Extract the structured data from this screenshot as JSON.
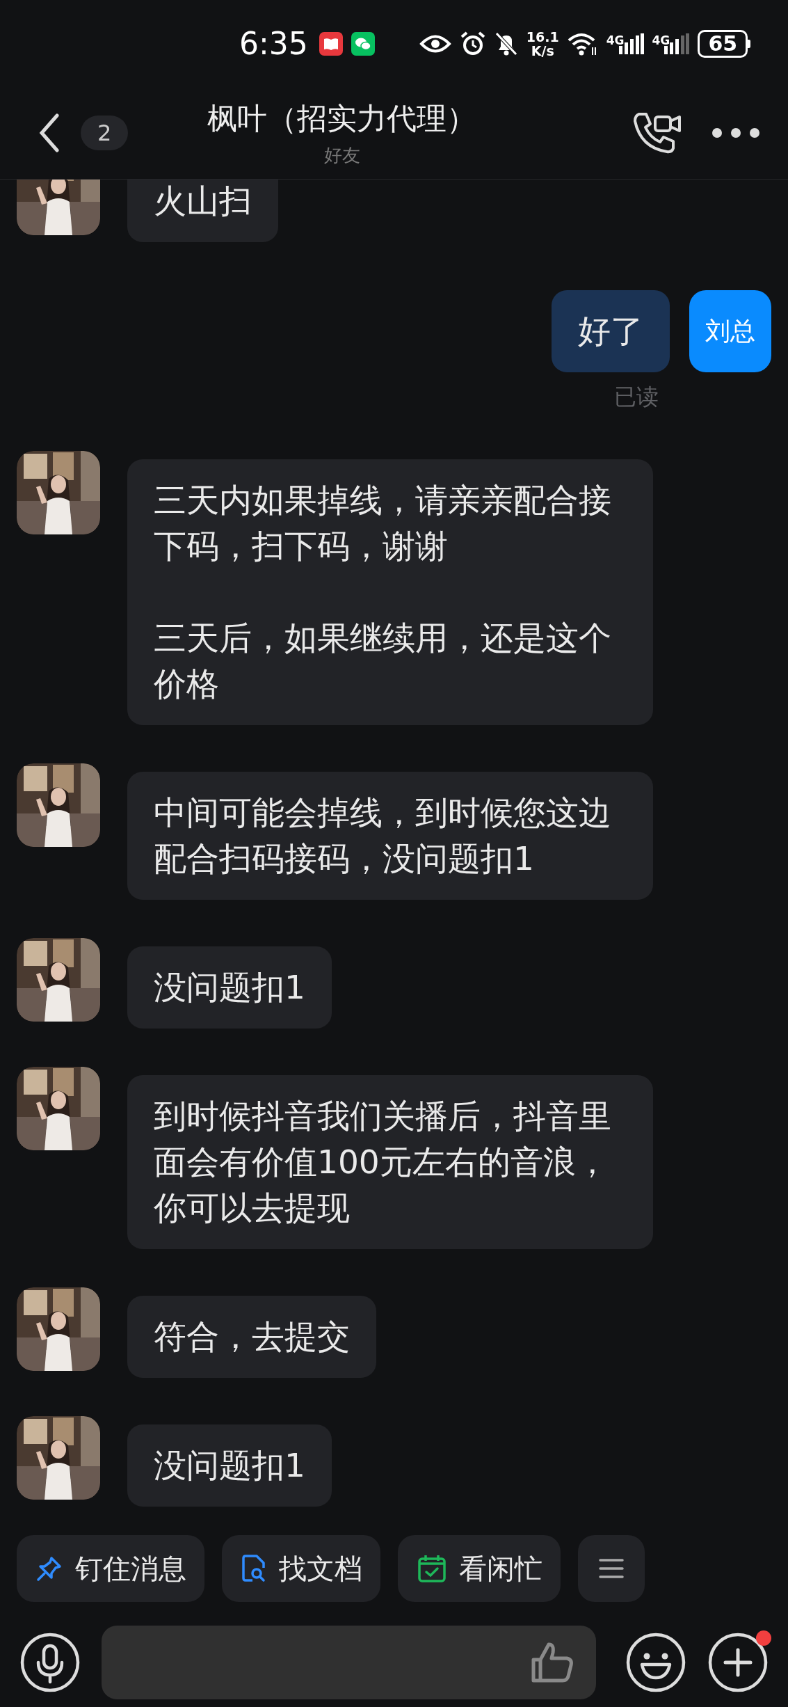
{
  "status_bar": {
    "time": "6:35",
    "speed": "16.1",
    "speed_unit": "K/s",
    "networks": [
      "4G",
      "4G"
    ],
    "battery": "65"
  },
  "header": {
    "unread": "2",
    "title": "枫叶（招实力代理）",
    "subtitle": "好友"
  },
  "messages": [
    {
      "kind": "incoming",
      "paragraphs": [
        "火山扫"
      ]
    },
    {
      "kind": "outgoing",
      "paragraphs": [
        "好了"
      ],
      "avatar_text": "刘总",
      "receipt": "已读"
    },
    {
      "kind": "incoming",
      "paragraphs": [
        "三天内如果掉线，请亲亲配合接下码，扫下码，谢谢",
        "三天后，如果继续用，还是这个价格"
      ]
    },
    {
      "kind": "incoming",
      "paragraphs": [
        "中间可能会掉线，到时候您这边配合扫码接码，没问题扣1"
      ]
    },
    {
      "kind": "incoming",
      "paragraphs": [
        "没问题扣1"
      ]
    },
    {
      "kind": "incoming",
      "paragraphs": [
        "到时候抖音我们关播后，抖音里面会有价值100元左右的音浪，你可以去提现"
      ]
    },
    {
      "kind": "incoming",
      "paragraphs": [
        "符合，去提交"
      ]
    },
    {
      "kind": "incoming",
      "paragraphs": [
        "没问题扣1"
      ]
    }
  ],
  "quick_actions": [
    {
      "kind": "pin",
      "label": "钉住消息"
    },
    {
      "kind": "doc",
      "label": "找文档"
    },
    {
      "kind": "calendar",
      "label": "看闲忙"
    },
    {
      "kind": "menu"
    }
  ],
  "composer": {
    "plus_badge": true
  }
}
